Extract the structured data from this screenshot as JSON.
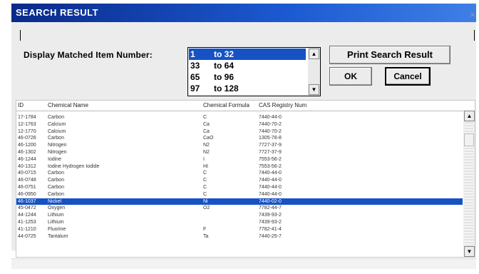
{
  "window": {
    "title": "SEARCH RESULT",
    "close_glyph": "×"
  },
  "display_matched": {
    "label": "Display Matched Item Number:",
    "options": [
      {
        "from": "1",
        "to_label": "to 32",
        "selected": true
      },
      {
        "from": "33",
        "to_label": "to 64",
        "selected": false
      },
      {
        "from": "65",
        "to_label": "to 96",
        "selected": false
      },
      {
        "from": "97",
        "to_label": "to 128",
        "selected": false
      }
    ]
  },
  "buttons": {
    "print": "Print Search Result",
    "ok": "OK",
    "cancel": "Cancel"
  },
  "table": {
    "columns": [
      "ID",
      "Chemical Name",
      "Chemical Formula",
      "CAS Registry Num"
    ],
    "rows": [
      {
        "id": "17-1784",
        "name": "Carbon",
        "formula": "C",
        "cas": "7440-44-0",
        "selected": false
      },
      {
        "id": "12-1763",
        "name": "Calcium",
        "formula": "Ca",
        "cas": "7440-70-2",
        "selected": false
      },
      {
        "id": "12-1770",
        "name": "Calcium",
        "formula": "Ca",
        "cas": "7440-70-2",
        "selected": false
      },
      {
        "id": "46-0726",
        "name": "Carbon",
        "formula": "CaO",
        "cas": "1305-78-8",
        "selected": false
      },
      {
        "id": "46-1200",
        "name": "Nitrogen",
        "formula": "N2",
        "cas": "7727-37-9",
        "selected": false
      },
      {
        "id": "46-1302",
        "name": "Nitrogen",
        "formula": "N2",
        "cas": "7727-37-9",
        "selected": false
      },
      {
        "id": "46-1244",
        "name": "Iodine",
        "formula": "I",
        "cas": "7553-56-2",
        "selected": false
      },
      {
        "id": "40-1312",
        "name": "Iodine Hydrogen Iodide",
        "formula": "HI",
        "cas": "7553-56-2",
        "selected": false
      },
      {
        "id": "40-0715",
        "name": "Carbon",
        "formula": "C",
        "cas": "7440-44-0",
        "selected": false
      },
      {
        "id": "46-0748",
        "name": "Carbon",
        "formula": "C",
        "cas": "7440-44-0",
        "selected": false
      },
      {
        "id": "46-0751",
        "name": "Carbon",
        "formula": "C",
        "cas": "7440-44-0",
        "selected": false
      },
      {
        "id": "46-0950",
        "name": "Carbon",
        "formula": "C",
        "cas": "7440-44-0",
        "selected": false
      },
      {
        "id": "46-1037",
        "name": "Nickel",
        "formula": "Ni",
        "cas": "7440-02-0",
        "selected": true
      },
      {
        "id": "45-0472",
        "name": "Oxygen",
        "formula": "O2",
        "cas": "7782-44-7",
        "selected": false
      },
      {
        "id": "44-1244",
        "name": "Lithium",
        "formula": "",
        "cas": "7439-93-2",
        "selected": false
      },
      {
        "id": "41-1253",
        "name": "Lithium",
        "formula": "",
        "cas": "7439-93-2",
        "selected": false
      },
      {
        "id": "41-1210",
        "name": "Fluorine",
        "formula": "F",
        "cas": "7782-41-4",
        "selected": false
      },
      {
        "id": "44-0725",
        "name": "Tantalum",
        "formula": "Ta",
        "cas": "7440-25-7",
        "selected": false
      }
    ]
  },
  "icons": {
    "scroll_up": "▲",
    "scroll_down": "▼"
  },
  "colors": {
    "title_bar": "#1652c4",
    "selection": "#1652c4"
  }
}
